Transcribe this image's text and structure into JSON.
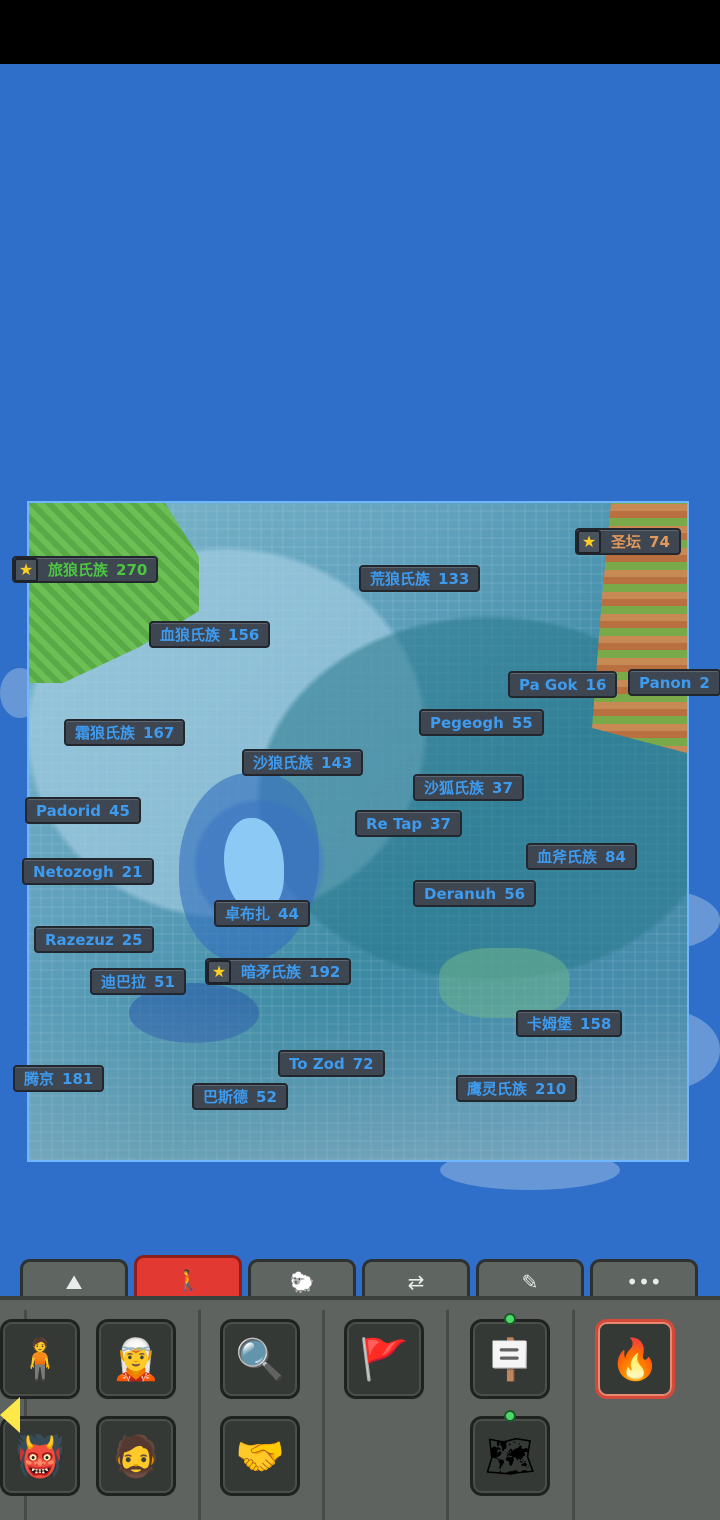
{
  "map": {
    "kingdoms": [
      {
        "name": "旅狼氏族",
        "pop": "270",
        "star": true,
        "color": "green"
      },
      {
        "name": "圣坛",
        "pop": "74",
        "star": true,
        "color": "orange"
      },
      {
        "name": "荒狼氏族",
        "pop": "133",
        "star": false,
        "color": "blue"
      },
      {
        "name": "血狼氏族",
        "pop": "156",
        "star": false,
        "color": "blue"
      },
      {
        "name": "Pa Gok",
        "pop": "16",
        "star": false,
        "color": "blue"
      },
      {
        "name": "Panon",
        "pop": "2",
        "star": false,
        "color": "blue"
      },
      {
        "name": "霜狼氏族",
        "pop": "167",
        "star": false,
        "color": "blue"
      },
      {
        "name": "Pegeogh",
        "pop": "55",
        "star": false,
        "color": "blue"
      },
      {
        "name": "沙狼氏族",
        "pop": "143",
        "star": false,
        "color": "blue"
      },
      {
        "name": "沙狐氏族",
        "pop": "37",
        "star": false,
        "color": "blue"
      },
      {
        "name": "Padorid",
        "pop": "45",
        "star": false,
        "color": "blue"
      },
      {
        "name": "Re Tap",
        "pop": "37",
        "star": false,
        "color": "blue"
      },
      {
        "name": "血斧氏族",
        "pop": "84",
        "star": false,
        "color": "blue"
      },
      {
        "name": "Netozogh",
        "pop": "21",
        "star": false,
        "color": "blue"
      },
      {
        "name": "Deranuh",
        "pop": "56",
        "star": false,
        "color": "blue"
      },
      {
        "name": "卓布扎",
        "pop": "44",
        "star": false,
        "color": "blue"
      },
      {
        "name": "Razezuz",
        "pop": "25",
        "star": false,
        "color": "blue"
      },
      {
        "name": "迪巴拉",
        "pop": "51",
        "star": false,
        "color": "blue"
      },
      {
        "name": "暗矛氏族",
        "pop": "192",
        "star": true,
        "color": "blue"
      },
      {
        "name": "卡姆堡",
        "pop": "158",
        "star": false,
        "color": "blue"
      },
      {
        "name": "To Zod",
        "pop": "72",
        "star": false,
        "color": "blue"
      },
      {
        "name": "腾京",
        "pop": "181",
        "star": false,
        "color": "blue"
      },
      {
        "name": "巴斯德",
        "pop": "52",
        "star": false,
        "color": "blue"
      },
      {
        "name": "鹰灵氏族",
        "pop": "210",
        "star": false,
        "color": "blue"
      }
    ]
  },
  "toolbar": {
    "tabs": [
      {
        "icon": "mountains-icon",
        "glyph": "⛰"
      },
      {
        "icon": "person-icon",
        "glyph": "🚶",
        "active": true
      },
      {
        "icon": "animal-icon",
        "glyph": "🐑"
      },
      {
        "icon": "swap-arrows-icon",
        "glyph": "⇄"
      },
      {
        "icon": "pencils-icon",
        "glyph": "✎"
      },
      {
        "icon": "more-icon",
        "glyph": "•••"
      }
    ],
    "slots": [
      {
        "icon": "human-unit-icon",
        "glyph": "🧍"
      },
      {
        "icon": "elf-unit-icon",
        "glyph": "🧝"
      },
      {
        "icon": "inspect-village-icon",
        "glyph": "🔍"
      },
      {
        "icon": "war-flag-icon",
        "glyph": "🚩"
      },
      {
        "icon": "signpost-icon",
        "glyph": "🪧"
      },
      {
        "icon": "fire-spell-icon",
        "glyph": "🔥"
      },
      {
        "icon": "orc-unit-icon",
        "glyph": "👹"
      },
      {
        "icon": "dwarf-unit-icon",
        "glyph": "🧔"
      },
      {
        "icon": "alliance-handshake-icon",
        "glyph": "🤝"
      },
      {
        "icon": "world-scroll-map-icon",
        "glyph": "🗺"
      }
    ]
  },
  "colors": {
    "accent_tab": "#e23a33",
    "label_text": "#3d9bf0",
    "star": "#ffd020"
  }
}
